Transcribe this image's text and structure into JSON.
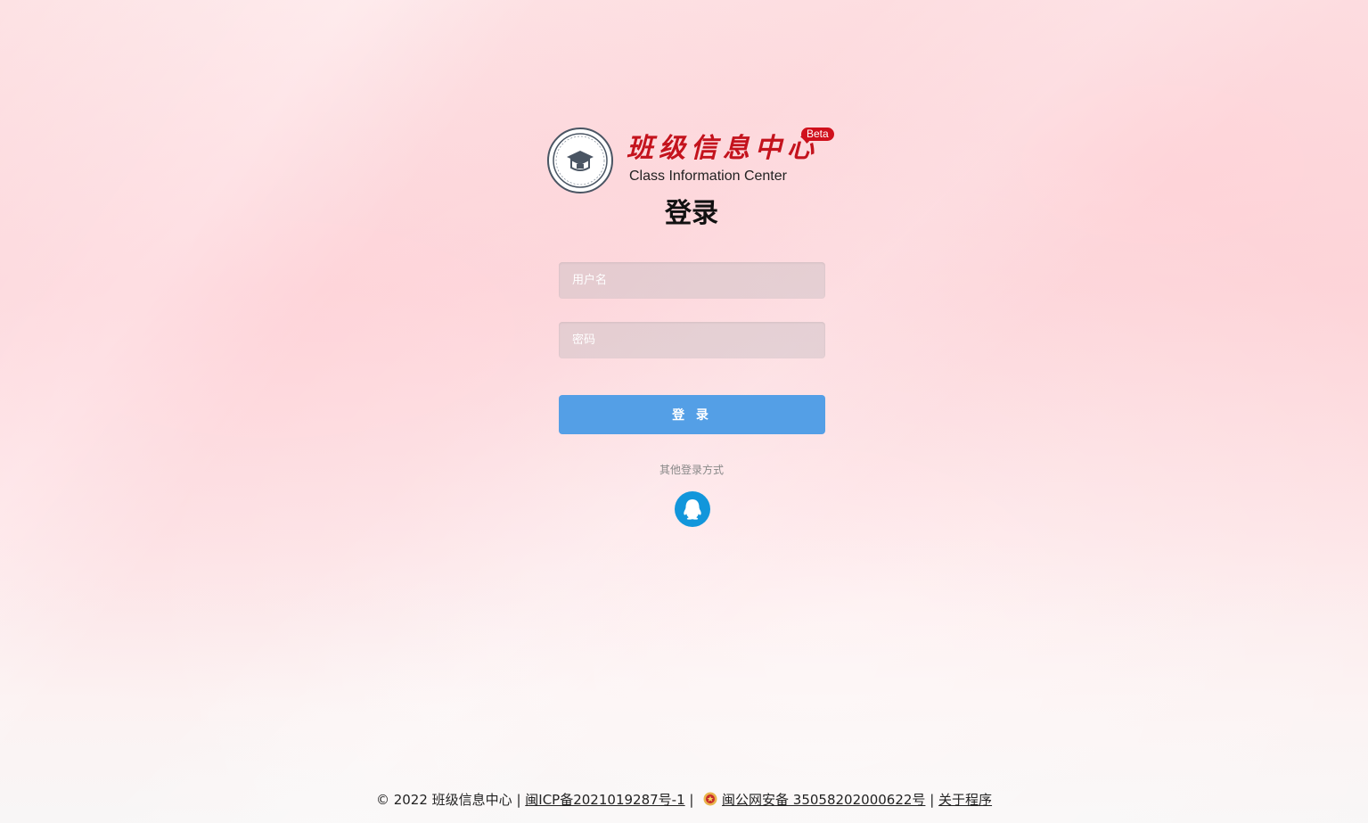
{
  "logo": {
    "name_cn": "班级信息中心",
    "name_en": "Class Information Center",
    "badge": "Beta"
  },
  "login": {
    "title": "登录",
    "username_placeholder": "用户名",
    "password_placeholder": "密码",
    "submit_label": "登 录",
    "other_methods_label": "其他登录方式",
    "other_methods": [
      "qq-icon"
    ]
  },
  "footer": {
    "copyright": "© 2022 班级信息中心",
    "sep1": "|",
    "icp": "闽ICP备2021019287号-1",
    "sep2": "|",
    "police": "闽公网安备 35058202000622号",
    "sep3": "|",
    "about": "关于程序"
  },
  "colors": {
    "brand_red": "#c4131d",
    "button_blue": "#549fe6",
    "qq_blue": "#1296db"
  }
}
